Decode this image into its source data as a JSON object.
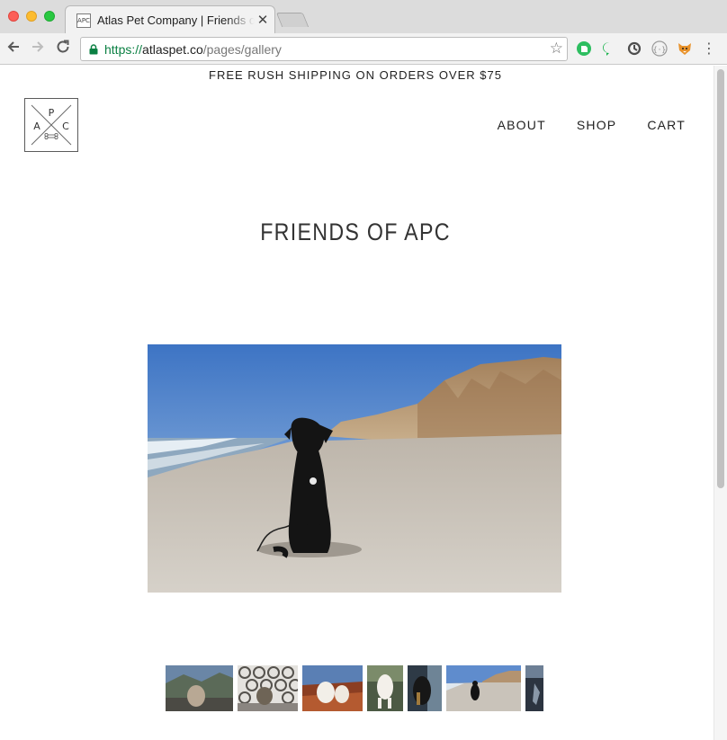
{
  "browser": {
    "tab_title": "Atlas Pet Company | Friends of APC",
    "tab_favicon_text": "APC",
    "close_glyph": "✕",
    "url_scheme": "https://",
    "url_host": "atlaspet.co",
    "url_path": "/pages/gallery",
    "nav_icons": [
      "back-arrow-icon",
      "forward-arrow-icon",
      "reload-icon"
    ],
    "star_glyph": "☆",
    "menu_glyph": "⋮",
    "extension_icons": [
      "evernote-icon",
      "chat-bubble-icon",
      "sync-icon",
      "code-brackets-icon",
      "fox-icon"
    ],
    "colors": {
      "secure_green": "#0b8043",
      "chrome_bg": "#f2f2f2"
    }
  },
  "site": {
    "announcement": "FREE RUSH SHIPPING ON ORDERS OVER $75",
    "logo": {
      "letters": [
        "A",
        "P",
        "C"
      ]
    },
    "nav": {
      "about": "ABOUT",
      "shop": "SHOP",
      "cart": "CART"
    },
    "page_title": "FRIENDS OF APC"
  },
  "gallery": {
    "selected_index": 5,
    "thumbnail_count": 7
  }
}
